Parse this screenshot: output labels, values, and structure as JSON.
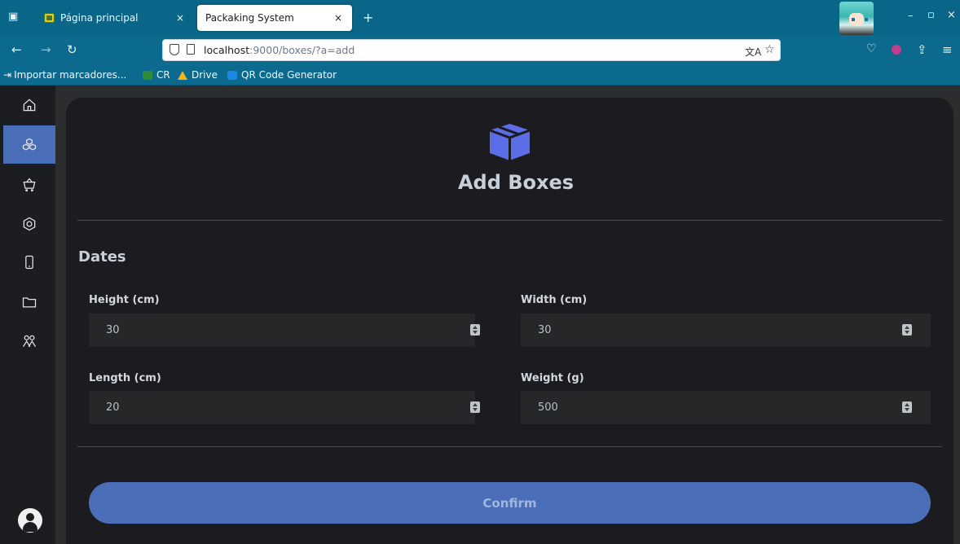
{
  "browser": {
    "tabs": [
      {
        "label": "Página principal",
        "active": false
      },
      {
        "label": "Packaking System",
        "active": true
      }
    ],
    "new_tab": "+",
    "tab_close": "×",
    "window_controls": {
      "minimize": "–",
      "restore": "▫",
      "close": "×"
    },
    "url": {
      "host": "localhost",
      "path": ":9000/boxes/?a=add"
    },
    "bookmarks": [
      {
        "label": "Importar marcadores...",
        "icon": "import-icon"
      },
      {
        "label": "CR",
        "icon": "cr-icon",
        "color": "#2e8b3a"
      },
      {
        "label": "Drive",
        "icon": "drive-icon",
        "color": "#f2b51b"
      },
      {
        "label": "QR Code Generator",
        "icon": "qr-icon",
        "color": "#1e88e5"
      }
    ]
  },
  "sidebar": {
    "items": [
      {
        "name": "home",
        "icon": "home-icon",
        "active": false
      },
      {
        "name": "boxes",
        "icon": "boxes-icon",
        "active": true
      },
      {
        "name": "cart",
        "icon": "cart-icon",
        "active": false
      },
      {
        "name": "settings",
        "icon": "hexagon-icon",
        "active": false
      },
      {
        "name": "device",
        "icon": "phone-icon",
        "active": false
      },
      {
        "name": "folder",
        "icon": "folder-icon",
        "active": false
      },
      {
        "name": "users",
        "icon": "users-icon",
        "active": false
      }
    ]
  },
  "page": {
    "title": "Add Boxes",
    "section_title": "Dates",
    "fields": {
      "height": {
        "label": "Height (cm)",
        "value": "30"
      },
      "width": {
        "label": "Width (cm)",
        "value": "30"
      },
      "length": {
        "label": "Length (cm)",
        "value": "20"
      },
      "weight": {
        "label": "Weight (g)",
        "value": "500"
      }
    },
    "confirm_label": "Confirm"
  },
  "colors": {
    "accent": "#4a6fb8",
    "box_icon": "#5b6ee8",
    "browser_chrome": "#0b6a8d",
    "card_bg": "#1c1b1f"
  }
}
